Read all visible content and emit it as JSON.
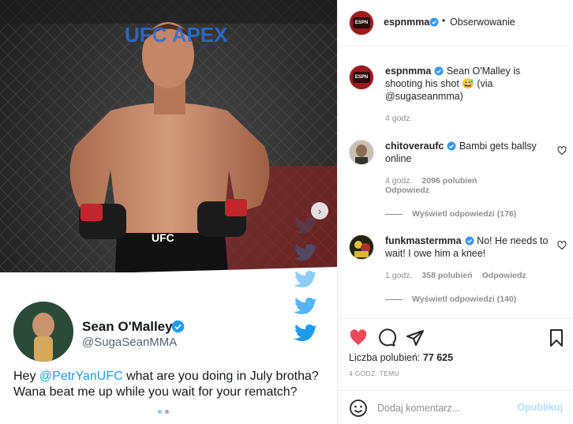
{
  "post": {
    "username": "espnmma",
    "follow_state": "Obserwowanie",
    "dot": "•",
    "avatar_text": "ESPN"
  },
  "tweet": {
    "banner": "UFC APEX",
    "display_name": "Sean O'Malley",
    "handle": "@SugaSeanMMA",
    "text_prefix": "Hey ",
    "mention": "@PetrYanUFC",
    "text_suffix": " what are you doing in July brotha? Wana beat me up while you wait for your rematch?"
  },
  "caption": {
    "username": "espnmma",
    "text": "Sean O'Malley is shooting his shot 😅 (via @sugaseanmma)",
    "time": "4 godz."
  },
  "comments": [
    {
      "username": "chitoveraufc",
      "text": "Bambi gets ballsy online",
      "time": "4 godz.",
      "likes": "2096 polubień",
      "reply": "Odpowiedz",
      "view_replies": "Wyświetl odpowiedzi (176)"
    },
    {
      "username": "funkmastermma",
      "text": "No! He needs to wait! I owe him a knee!",
      "time": "1 godz.",
      "likes": "358 polubień",
      "reply": "Odpowiedz",
      "view_replies": "Wyświetl odpowiedzi (140)"
    }
  ],
  "actions": {
    "likes_label": "Liczba polubień:",
    "likes_count": "77 625",
    "timestamp": "4 GODZ. TEMU"
  },
  "comment_box": {
    "placeholder": "Dodaj komentarz...",
    "publish": "Opublikuj"
  },
  "colors": {
    "like_red": "#ed4956",
    "verified_blue": "#3897f0",
    "twitter_blue": "#1d9bf0",
    "publish_disabled": "#b2dffc"
  },
  "icons": [
    "heart-icon",
    "comment-icon",
    "share-icon",
    "bookmark-icon",
    "emoji-icon",
    "verified-icon",
    "twitter-bird-icon",
    "chevron-right-icon"
  ]
}
